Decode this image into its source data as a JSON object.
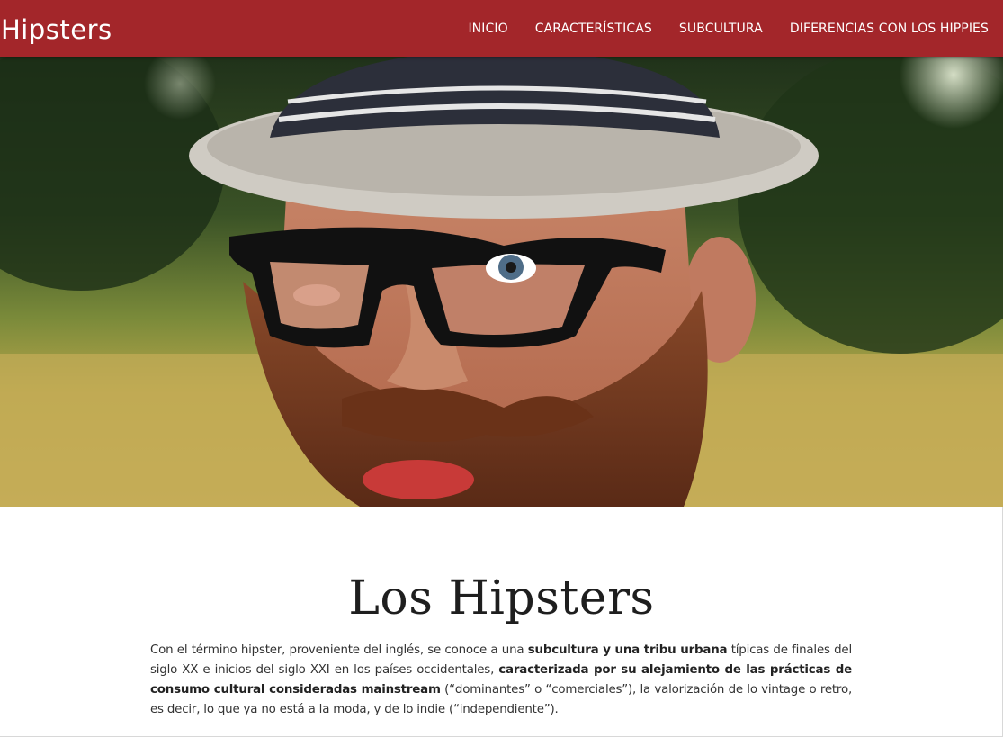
{
  "navbar": {
    "brand": "Hipsters",
    "background": "#a3262a",
    "links": [
      {
        "label": "INICIO"
      },
      {
        "label": "CARACTERÍSTICAS"
      },
      {
        "label": "SUBCULTURA"
      },
      {
        "label": "DIFERENCIAS CON LOS HIPPIES"
      }
    ]
  },
  "hero": {
    "image": "bearded-man-with-hat-and-glasses-photo"
  },
  "main": {
    "title": "Los Hipsters",
    "paragraph": {
      "t1": "Con el término hipster, proveniente del inglés, se conoce a una ",
      "b1": "subcultura y una tribu urbana",
      "t2": " típicas de finales del siglo XX e inicios del siglo XXI en los países occidentales, ",
      "b2": "caracterizada por su alejamiento de las prácticas de consumo cultural consideradas mainstream",
      "t3": " (“dominantes” o “comerciales”), la valorización de lo vintage o retro, es decir, lo que ya no está a la moda, y de lo indie (“independiente”)."
    }
  }
}
